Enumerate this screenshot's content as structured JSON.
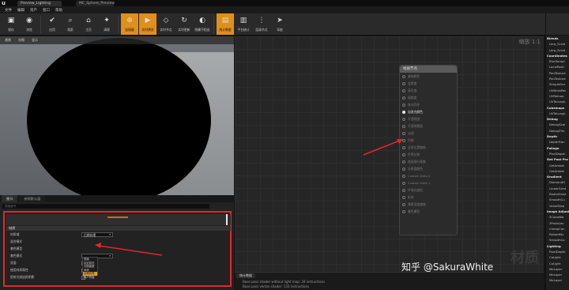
{
  "window": {
    "document_tab": "Preview_Lighting",
    "second_tab": "MC_Sphere_Preview"
  },
  "menu": [
    "文件",
    "编辑",
    "资产",
    "窗口",
    "帮助"
  ],
  "toolbar": [
    {
      "label": "保存",
      "icon": "save-icon"
    },
    {
      "label": "浏览",
      "icon": "browse-icon"
    },
    {
      "label": "应用",
      "icon": "apply-icon"
    },
    {
      "label": "搜索",
      "icon": "search-icon"
    },
    {
      "label": "主页",
      "icon": "home-icon"
    },
    {
      "label": "清理",
      "icon": "clean-icon"
    },
    {
      "label": "连接器",
      "icon": "connector-icon",
      "active": true
    },
    {
      "label": "实时预览",
      "icon": "live-preview-icon",
      "active": true
    },
    {
      "label": "实时节点",
      "icon": "live-nodes-icon"
    },
    {
      "label": "实时更新",
      "icon": "live-update-icon"
    },
    {
      "label": "隐藏不相连",
      "icon": "hide-unrelated-icon"
    },
    {
      "label": "统计数据",
      "icon": "stats-icon",
      "active": true
    },
    {
      "label": "平台统计",
      "icon": "platform-stats-icon"
    },
    {
      "label": "层级节点",
      "icon": "level-nodes-icon"
    },
    {
      "label": "导航",
      "icon": "nav-icon"
    }
  ],
  "viewport": {
    "header_buttons": [
      "透视",
      "光照",
      "显示"
    ]
  },
  "graph": {
    "zoom_label": "缩放 1:1",
    "node_title": "材质节点",
    "pins": [
      {
        "label": "基础颜色",
        "on": false
      },
      {
        "label": "金属度",
        "on": false
      },
      {
        "label": "高光度",
        "on": false
      },
      {
        "label": "粗糙度",
        "on": false
      },
      {
        "label": "各向异性",
        "on": false
      },
      {
        "label": "自发光颜色",
        "on": true
      },
      {
        "label": "不透明度",
        "on": false
      },
      {
        "label": "不透明蒙版",
        "on": false
      },
      {
        "label": "法线",
        "on": false
      },
      {
        "label": "切线",
        "on": false
      },
      {
        "label": "全局位置偏移",
        "on": false
      },
      {
        "label": "世界位移",
        "on": false
      },
      {
        "label": "曲面细分乘数",
        "on": false
      },
      {
        "label": "次表面颜色",
        "on": false
      },
      {
        "label": "Custom Data 0",
        "on": false
      },
      {
        "label": "Custom Data 1",
        "on": false
      },
      {
        "label": "环境光遮挡",
        "on": false
      },
      {
        "label": "折射",
        "on": false
      },
      {
        "label": "像素深度偏移",
        "on": false
      },
      {
        "label": "着色模型",
        "on": false
      }
    ],
    "watermark": "材质"
  },
  "stats": {
    "tab": "统计数据",
    "lines": [
      "Base pass shader without light map: 34 instructions",
      "Base pass vertex shader: 133 instructions"
    ]
  },
  "details": {
    "tabs": [
      "细节",
      "参数默认值"
    ],
    "search_placeholder": "搜索细节",
    "section": "材质",
    "rows": [
      {
        "name": "材质域",
        "type": "dropdown",
        "value": "后期处理"
      },
      {
        "name": "混合模式",
        "type": "dropdown",
        "value": ""
      },
      {
        "name": "着色模型",
        "type": "dropdown",
        "value": ""
      },
      {
        "name": "着色模式",
        "type": "dropdown",
        "value": ""
      },
      {
        "name": "双面",
        "type": "checkbox",
        "value": false
      },
      {
        "name": "使用材质属性",
        "type": "checkbox",
        "value": false
      },
      {
        "name": "投射光线追踪阴影",
        "type": "checkbox",
        "value": true
      }
    ],
    "dropdown_options": [
      "表面",
      "延迟贴花",
      "光照函数",
      "体积",
      "后期处理",
      "用户界面"
    ],
    "dropdown_selected_index": 4
  },
  "palette": [
    {
      "label": "Blends",
      "cat": true
    },
    {
      "label": "Lerp_Scrat"
    },
    {
      "label": "Lerp_Scrat"
    },
    {
      "label": "Coordinates",
      "cat": true
    },
    {
      "label": "BlurSampl"
    },
    {
      "label": "LocalPosit"
    },
    {
      "label": "PanTexture"
    },
    {
      "label": "PanTexture"
    },
    {
      "label": "SimpleGra"
    },
    {
      "label": "UVBrickPat"
    },
    {
      "label": "UVRemap"
    },
    {
      "label": "UVToLongL"
    },
    {
      "label": "Cubemaps",
      "cat": true
    },
    {
      "label": "UVToLongL"
    },
    {
      "label": "Debug",
      "cat": true
    },
    {
      "label": "DebugScal"
    },
    {
      "label": "DebugTim"
    },
    {
      "label": "Depth",
      "cat": true
    },
    {
      "label": "DepthFron"
    },
    {
      "label": "Foliage",
      "cat": true
    },
    {
      "label": "PixelDepth"
    },
    {
      "label": "Get Post Pro",
      "cat": true
    },
    {
      "label": "GetAmbie"
    },
    {
      "label": "GetAmbie"
    },
    {
      "label": "Gradient",
      "cat": true
    },
    {
      "label": "DiamondG"
    },
    {
      "label": "LinearGrad"
    },
    {
      "label": "RadialGrad"
    },
    {
      "label": "SmoothCu"
    },
    {
      "label": "ValueStep"
    },
    {
      "label": "Image Adjust",
      "cat": true
    },
    {
      "label": "3ColorBle"
    },
    {
      "label": "3PointLev"
    },
    {
      "label": "CheapCon"
    },
    {
      "label": "RaisedEtc"
    },
    {
      "label": "SmoothCo"
    },
    {
      "label": "Lighting",
      "cat": true
    },
    {
      "label": "PixelDepth"
    },
    {
      "label": "CoLight"
    },
    {
      "label": "CoLight"
    },
    {
      "label": "MeLayer"
    },
    {
      "label": "MeLayer"
    },
    {
      "label": "MeLayer"
    }
  ],
  "watermark": "知乎 @SakuraWhite",
  "colors": {
    "highlight_frame": "#e3262d",
    "active_button": "#e08f1b",
    "selected_option": "#d9a12a"
  }
}
